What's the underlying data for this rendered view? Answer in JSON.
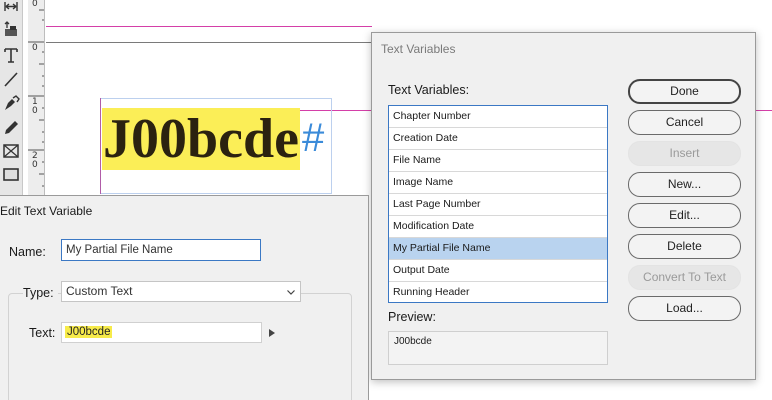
{
  "tools": [
    {
      "icon": "horizontal-arrows-icon"
    },
    {
      "icon": "content-placer-icon"
    },
    {
      "icon": "type-tool-icon"
    },
    {
      "icon": "line-tool-icon"
    },
    {
      "icon": "pen-tool-icon"
    },
    {
      "icon": "pencil-tool-icon"
    },
    {
      "icon": "rectangle-frame-icon"
    },
    {
      "icon": "rectangle-tool-icon"
    }
  ],
  "ruler": {
    "marks": [
      "0",
      "0",
      "1\n0",
      "2\n0"
    ]
  },
  "canvas": {
    "sample_text": "J00bcde",
    "hidden_char": "#",
    "highlight_color": "#fbee57",
    "guide_color": "#d43fa8"
  },
  "text_variables_dialog": {
    "title": "Text Variables",
    "list_label": "Text Variables:",
    "items": [
      "Chapter Number",
      "Creation Date",
      "File Name",
      "Image Name",
      "Last Page Number",
      "Modification Date",
      "My Partial File Name",
      "Output Date",
      "Running Header"
    ],
    "selected_item": "My Partial File Name",
    "preview_label": "Preview:",
    "preview_value": "J00bcde",
    "buttons": {
      "done": "Done",
      "cancel": "Cancel",
      "insert": "Insert",
      "new": "New...",
      "edit": "Edit...",
      "delete": "Delete",
      "convert": "Convert To Text",
      "load": "Load..."
    }
  },
  "edit_text_variable_dialog": {
    "title": "Edit Text Variable",
    "name_label": "Name:",
    "name_value": "My Partial File Name",
    "type_label": "Type:",
    "type_value": "Custom Text",
    "text_label": "Text:",
    "text_value": "J00bcde"
  }
}
